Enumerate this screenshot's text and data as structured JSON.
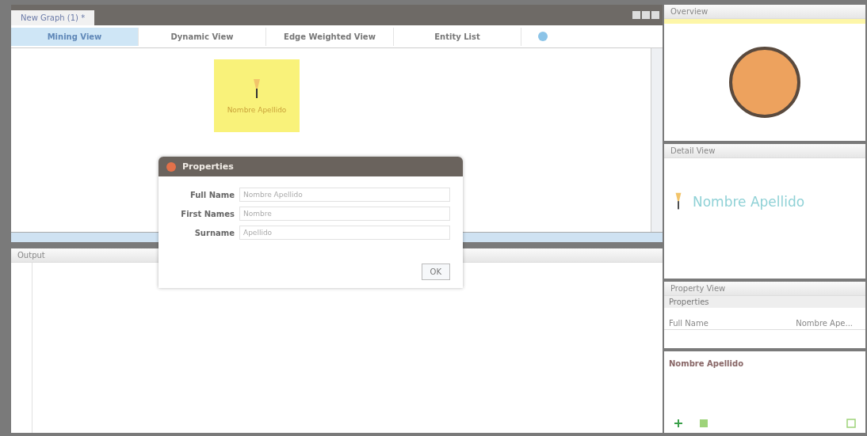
{
  "editor_tab": {
    "title": "New Graph (1) *"
  },
  "view_tabs": [
    {
      "label": "Mining View",
      "selected": true
    },
    {
      "label": "Dynamic View",
      "selected": false
    },
    {
      "label": "Edge Weighted View",
      "selected": false
    },
    {
      "label": "Entity List",
      "selected": false
    }
  ],
  "canvas": {
    "node": {
      "label": "Nombre Apellido"
    }
  },
  "dialog": {
    "title": "Properties",
    "fields": [
      {
        "label": "Full Name",
        "value": "Nombre Apellido"
      },
      {
        "label": "First Names",
        "value": "Nombre"
      },
      {
        "label": "Surname",
        "value": "Apellido"
      }
    ],
    "button": "OK"
  },
  "output_panel": {
    "title": "Output"
  },
  "overview_panel": {
    "title": "Overview"
  },
  "detail_panel": {
    "title": "Detail View",
    "entity": "Nombre Apellido"
  },
  "property_panel": {
    "title": "Property View",
    "section": "Properties",
    "rows": [
      {
        "name": "Full Name",
        "value": "Nombre Ape..."
      }
    ]
  },
  "entity_label": "Nombre Apellido"
}
